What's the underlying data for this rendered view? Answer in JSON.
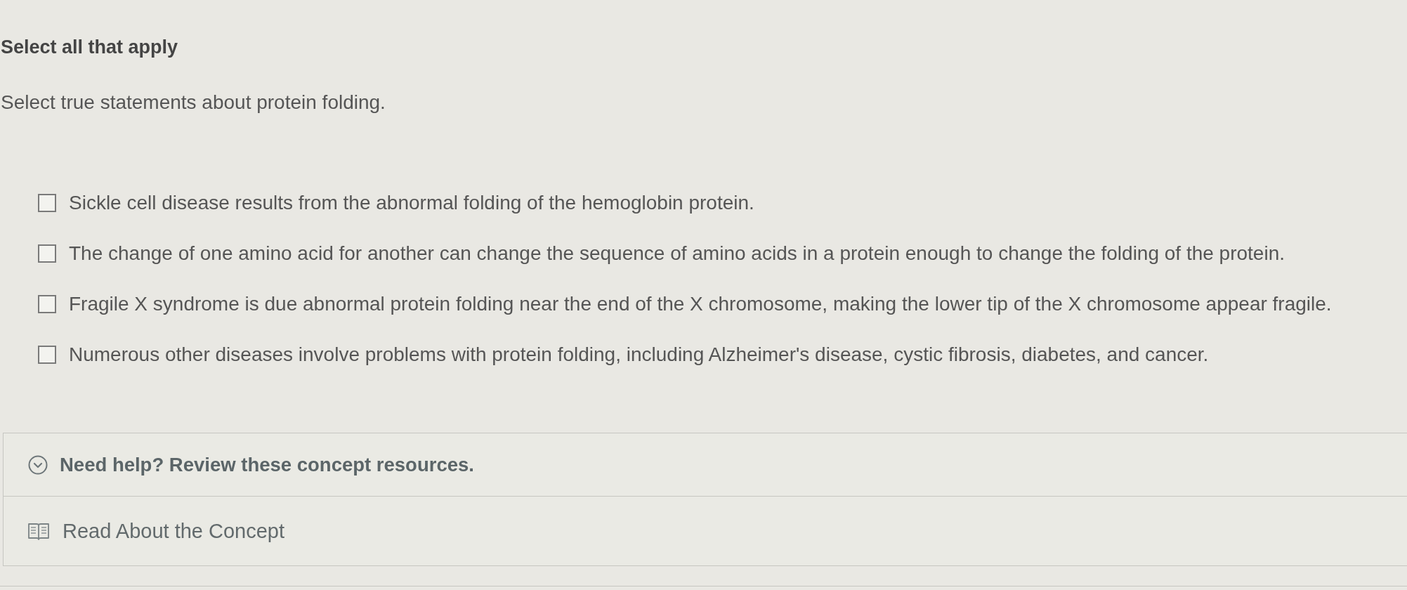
{
  "prompt": {
    "instruction": "Select all that apply",
    "question": "Select true statements about protein folding."
  },
  "options": [
    {
      "label": "Sickle cell disease results from the abnormal folding of the hemoglobin protein.",
      "checked": false
    },
    {
      "label": "The change of one amino acid for another can change the sequence of amino acids in a protein enough to change the folding of the protein.",
      "checked": false
    },
    {
      "label": "Fragile X syndrome is due abnormal protein folding near the end of the X chromosome, making the lower tip of the X chromosome appear fragile.",
      "checked": false
    },
    {
      "label": "Numerous other diseases involve problems with protein folding, including Alzheimer's disease, cystic fibrosis, diabetes, and cancer.",
      "checked": false
    }
  ],
  "help": {
    "title": "Need help? Review these concept resources.",
    "resources": [
      {
        "label": "Read About the Concept"
      }
    ]
  }
}
